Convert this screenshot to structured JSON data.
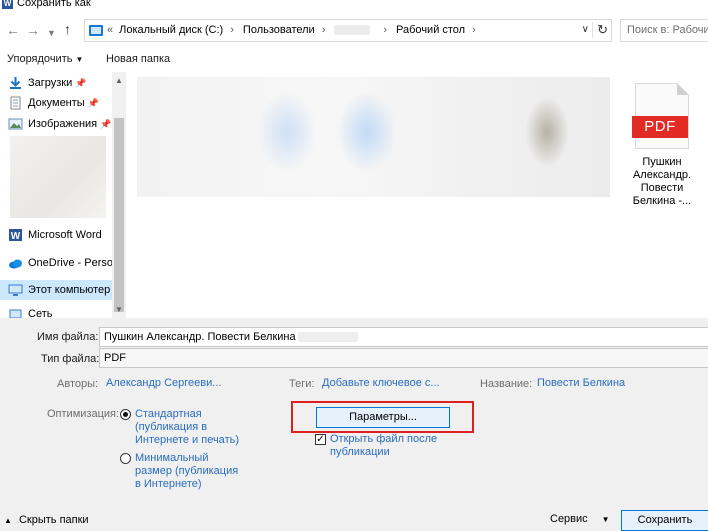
{
  "window": {
    "title": "Сохранить как",
    "app_icon": "W"
  },
  "address": {
    "crumbs": [
      "Локальный диск (C:)",
      "Пользователи",
      "Рабочий стол"
    ],
    "search_placeholder": "Поиск в: Рабочий стол"
  },
  "toolbar": {
    "organize": "Упорядочить",
    "new_folder": "Новая папка"
  },
  "sidebar": {
    "items": [
      {
        "label": "Загрузки",
        "icon": "download-arrow-icon"
      },
      {
        "label": "Документы",
        "icon": "documents-icon"
      },
      {
        "label": "Изображения",
        "icon": "pictures-icon"
      },
      {
        "label": "Microsoft Word",
        "icon": "word-icon"
      },
      {
        "label": "OneDrive - Personal",
        "icon": "onedrive-icon"
      },
      {
        "label": "Этот компьютер",
        "icon": "computer-icon"
      },
      {
        "label": "Сеть",
        "icon": "network-icon"
      }
    ]
  },
  "files": [
    {
      "badge": "PDF",
      "name": "Пушкин Александр. Повести Белкина -..."
    }
  ],
  "form": {
    "filename_label": "Имя файла:",
    "filename_value": "Пушкин Александр. Повести Белкина",
    "filetype_label": "Тип файла:",
    "filetype_value": "PDF",
    "authors_label": "Авторы:",
    "authors_value": "Александр Сергееви...",
    "tags_label": "Теги:",
    "tags_value": "Добавьте ключевое с...",
    "title_label": "Название:",
    "title_value": "Повести Белкина",
    "optimize_label": "Оптимизация:",
    "opt_standard": [
      "Стандартная",
      "(публикация в",
      "Интернете и печать)"
    ],
    "opt_minimal": [
      "Минимальный",
      "размер (публикация",
      "в Интернете)"
    ],
    "selected_option": "standard",
    "params_button": "Параметры...",
    "open_after_publish": [
      "Открыть файл после",
      "публикации"
    ],
    "open_after_publish_checked": true
  },
  "footer": {
    "hide_folders": "Скрыть папки",
    "service": "Сервис",
    "save": "Сохранить"
  },
  "colors": {
    "accent": "#0078d7",
    "link": "#2a6dbf",
    "highlight": "#e02020",
    "pdf_badge": "#e32b25"
  }
}
